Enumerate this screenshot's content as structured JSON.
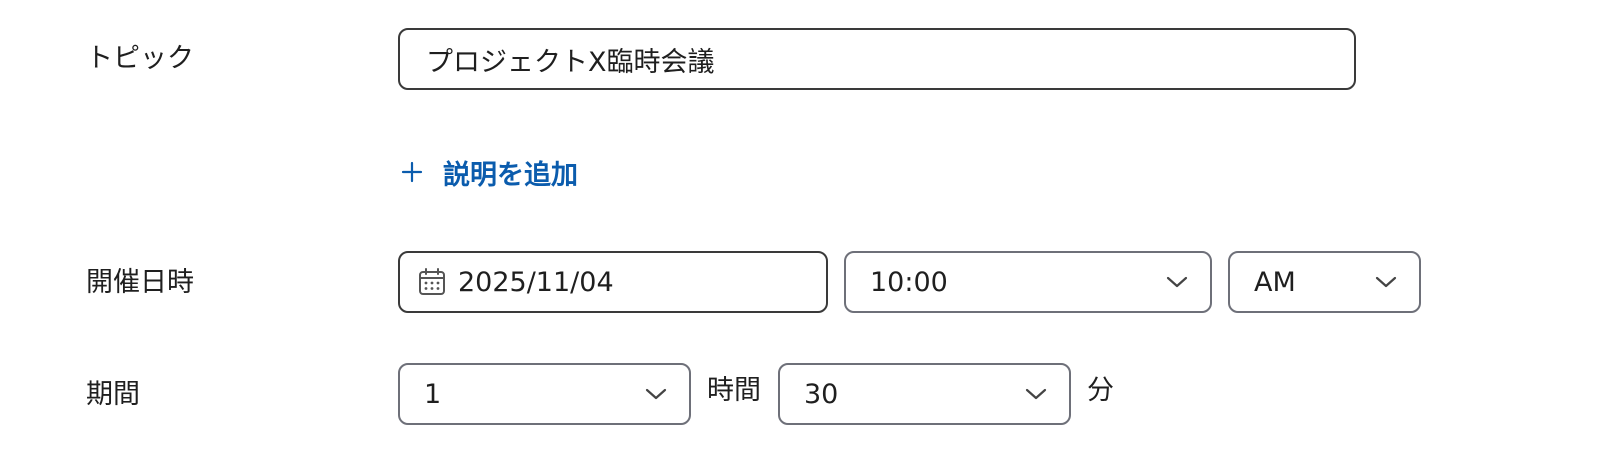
{
  "form": {
    "topic": {
      "label": "トピック",
      "value": "プロジェクトX臨時会議"
    },
    "add_description": {
      "label": "説明を追加"
    },
    "datetime": {
      "label": "開催日時",
      "date": "2025/11/04",
      "time": "10:00",
      "ampm": "AM"
    },
    "duration": {
      "label": "期間",
      "hours": "1",
      "hours_unit": "時間",
      "minutes": "30",
      "minutes_unit": "分"
    }
  },
  "colors": {
    "link": "#0b5cad",
    "border": "#6e7079",
    "text": "#1f1f1f"
  },
  "icons": {
    "add": "plus-icon",
    "calendar": "calendar-icon",
    "dropdown": "chevron-down-icon"
  }
}
